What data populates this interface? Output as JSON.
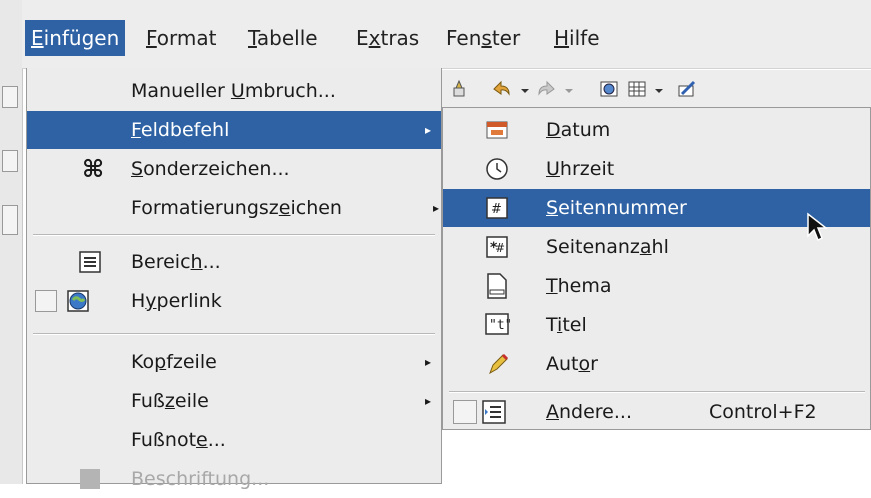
{
  "menubar": {
    "items": [
      {
        "label": "Einfügen",
        "ul": 0
      },
      {
        "label": "Format",
        "ul": 0
      },
      {
        "label": "Tabelle",
        "ul": 0
      },
      {
        "label": "Extras",
        "ul": 1
      },
      {
        "label": "Fenster",
        "ul": 3
      },
      {
        "label": "Hilfe",
        "ul": 0
      }
    ]
  },
  "insert_menu": {
    "items": [
      {
        "label": "Manueller Umbruch...",
        "ul": 10,
        "icon": null,
        "submenu": false
      },
      {
        "label": "Feldbefehl",
        "ul": 0,
        "icon": null,
        "submenu": true,
        "highlighted": true
      },
      {
        "label": "Sonderzeichen...",
        "ul": 0,
        "icon": "command-icon",
        "submenu": false
      },
      {
        "label": "Formatierungszeichen",
        "ul": 14,
        "icon": null,
        "submenu": true
      },
      {
        "label": "Bereich...",
        "ul": 6,
        "icon": "section-icon",
        "submenu": false
      },
      {
        "label": "Hyperlink",
        "ul": 1,
        "icon": "hyperlink-globe-icon",
        "submenu": false
      },
      {
        "label": "Kopfzeile",
        "ul": 2,
        "icon": null,
        "submenu": true
      },
      {
        "label": "Fußzeile",
        "ul": 3,
        "icon": null,
        "submenu": true
      },
      {
        "label": "Fußnote...",
        "ul": 6,
        "icon": null,
        "submenu": false
      },
      {
        "label": "Beschriftung...",
        "ul": -1,
        "icon": "caption-icon",
        "submenu": false,
        "disabled": true
      }
    ]
  },
  "field_submenu": {
    "items": [
      {
        "label": "Datum",
        "ul": 0,
        "icon": "calendar-icon"
      },
      {
        "label": "Uhrzeit",
        "ul": 0,
        "icon": "clock-icon"
      },
      {
        "label": "Seitennummer",
        "ul": 0,
        "icon": "page-number-icon",
        "highlighted": true
      },
      {
        "label": "Seitenanzahl",
        "ul": 9,
        "icon": "page-count-icon"
      },
      {
        "label": "Thema",
        "ul": 0,
        "icon": "subject-document-icon"
      },
      {
        "label": "Titel",
        "ul": 1,
        "icon": "title-quote-icon"
      },
      {
        "label": "Autor",
        "ul": 3,
        "icon": "author-pen-icon"
      },
      {
        "label": "Andere...",
        "ul": 0,
        "icon": "other-fields-icon",
        "shortcut": "Control+F2"
      }
    ]
  },
  "colors": {
    "highlight": "#2e62a4",
    "menu_bg": "#ececec"
  }
}
